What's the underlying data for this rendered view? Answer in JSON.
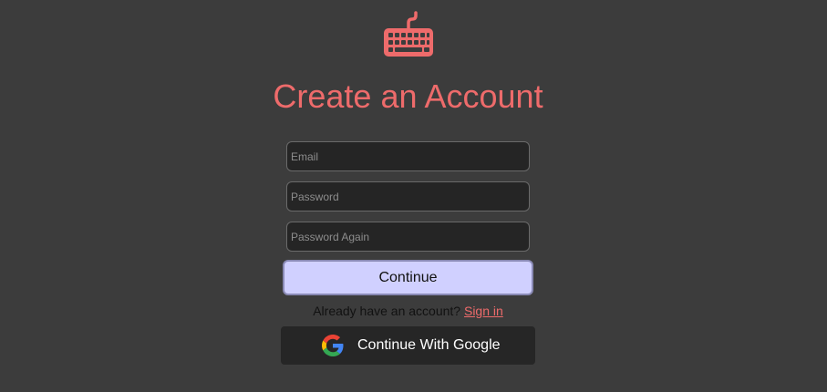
{
  "colors": {
    "background": "#3c3c3c",
    "accent": "#ee6b6b",
    "input_background": "#252525",
    "continue_button": "#d0d0ff",
    "google_button": "#262626"
  },
  "logo": {
    "icon": "keyboard-icon"
  },
  "title": "Create an Account",
  "form": {
    "email_placeholder": "Email",
    "password_placeholder": "Password",
    "password_again_placeholder": "Password Again",
    "continue_label": "Continue"
  },
  "signin": {
    "prompt": "Already have an account?",
    "link_label": "Sign in"
  },
  "google": {
    "icon": "google-icon",
    "label": "Continue With Google"
  }
}
